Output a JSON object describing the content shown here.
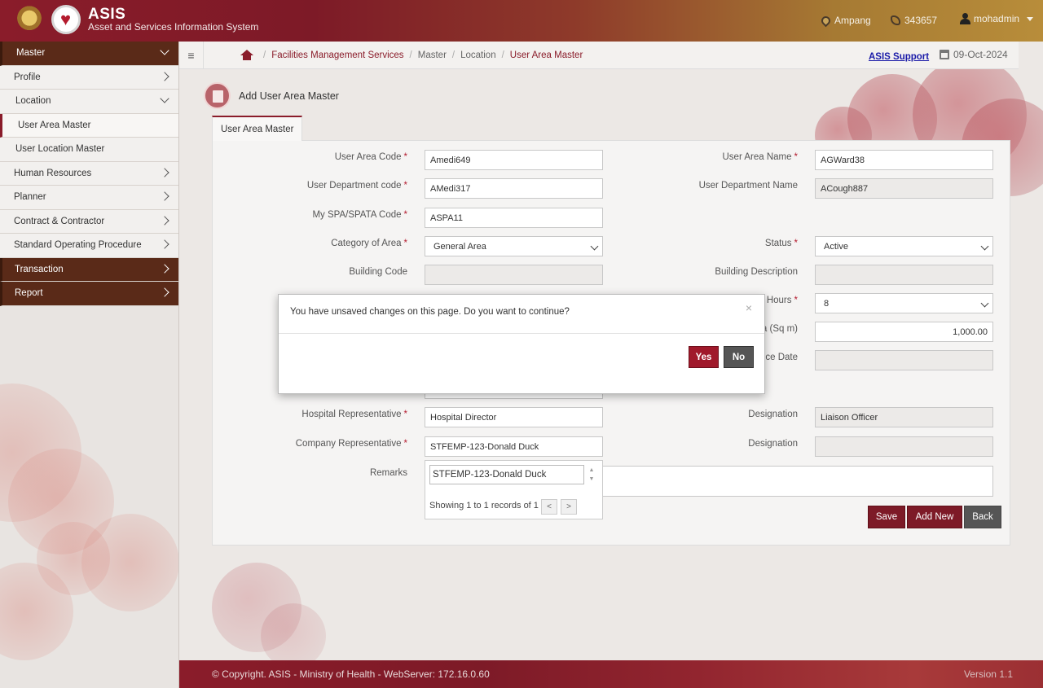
{
  "header": {
    "title": "ASIS",
    "subtitle": "Asset and Services Information System",
    "location": "Ampang",
    "phone": "343657",
    "user": "mohadmin"
  },
  "sidebar": {
    "items": [
      {
        "label": "Master"
      },
      {
        "label": "Profile"
      },
      {
        "label": "Location"
      },
      {
        "label": "User Area Master"
      },
      {
        "label": "User Location Master"
      },
      {
        "label": "Human Resources"
      },
      {
        "label": "Planner"
      },
      {
        "label": "Contract & Contractor"
      },
      {
        "label": "Standard Operating Procedure"
      },
      {
        "label": "Transaction"
      },
      {
        "label": "Report"
      }
    ]
  },
  "breadcrumb": {
    "items": [
      "Facilities Management Services",
      "Master",
      "Location",
      "User Area Master"
    ]
  },
  "support_link": "ASIS Support",
  "date": "09-Oct-2024",
  "page": {
    "title": "Add User Area Master",
    "tab": "User Area Master"
  },
  "form": {
    "user_area_code": {
      "label": "User Area Code",
      "value": "Amedi649"
    },
    "user_area_name": {
      "label": "User Area Name",
      "value": "AGWard38"
    },
    "user_dept_code": {
      "label": "User Department code",
      "value": "AMedi317"
    },
    "user_dept_name": {
      "label": "User Department Name",
      "value": "ACough887"
    },
    "spa_code": {
      "label": "My SPA/SPATA Code",
      "value": "ASPA11"
    },
    "category": {
      "label": "Category of Area",
      "value": "General Area"
    },
    "status": {
      "label": "Status",
      "value": "Active"
    },
    "building_code": {
      "label": "Building Code",
      "value": ""
    },
    "building_desc": {
      "label": "Building Description",
      "value": ""
    },
    "hours_label": "Hours",
    "hours_value": "8",
    "area_label": "a (Sq m)",
    "area_value": "1,000.00",
    "date_label": "ce Date",
    "hospital_rep": {
      "label": "Hospital Representative",
      "value": "Hospital Director"
    },
    "hospital_designation": {
      "label": "Designation",
      "value": "Liaison Officer"
    },
    "company_rep": {
      "label": "Company Representative",
      "value": "STFEMP-123-Donald Duck"
    },
    "company_designation": {
      "label": "Designation",
      "value": ""
    },
    "remarks": {
      "label": "Remarks",
      "value": ""
    },
    "required_mark": "*"
  },
  "buttons": {
    "save": "Save",
    "add_new": "Add New",
    "back": "Back"
  },
  "modal": {
    "message": "You have unsaved changes on this page. Do you want to continue?",
    "close": "×",
    "yes": "Yes",
    "no": "No"
  },
  "lookup": {
    "value": "STFEMP-123-Donald Duck",
    "info": "Showing 1 to 1 records of 1",
    "prev": "<",
    "next": ">"
  },
  "footer": {
    "copyright": "© Copyright. ASIS - Ministry of Health - WebServer: 172.16.0.60",
    "version": "Version 1.1"
  },
  "colors": {
    "brand": "#8a1c2a",
    "yes_button": "#a0192b",
    "no_button": "#555555"
  }
}
